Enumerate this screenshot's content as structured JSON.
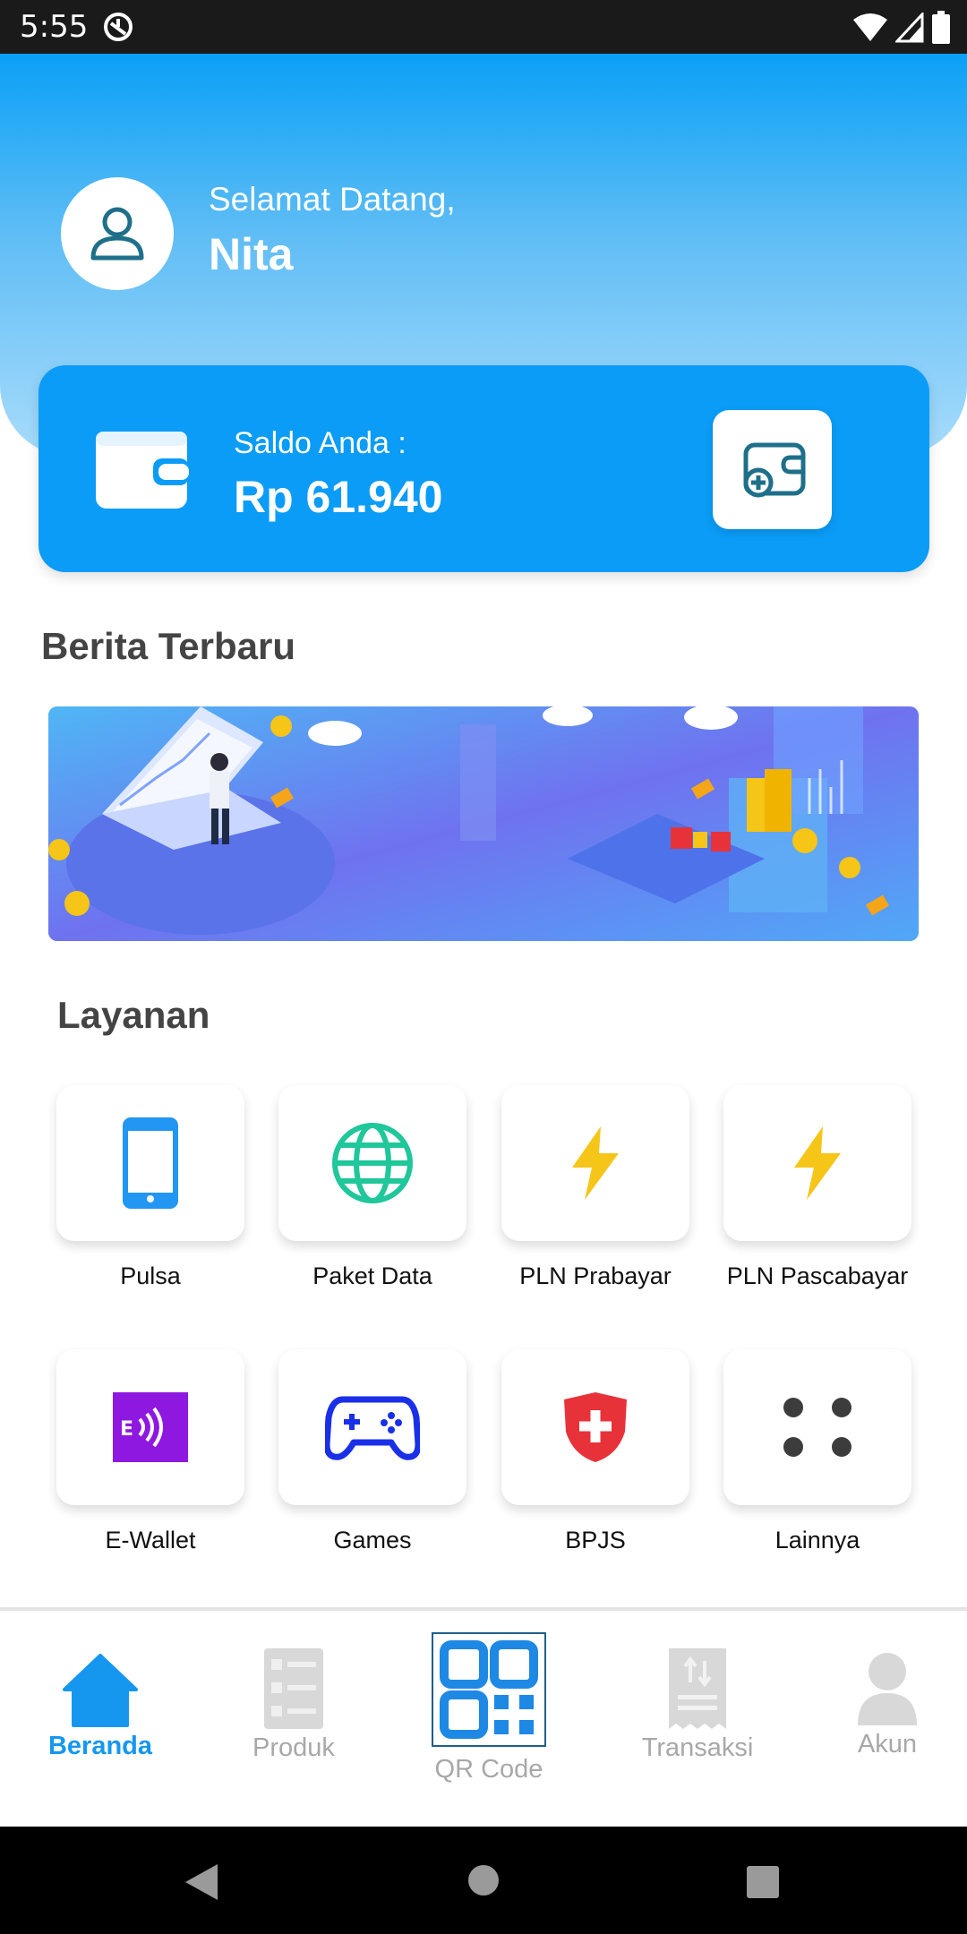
{
  "status_bar": {
    "time": "5:55"
  },
  "header": {
    "greeting": "Selamat Datang,",
    "username": "Nita"
  },
  "balance": {
    "label": "Saldo Anda :",
    "value": "Rp 61.940"
  },
  "news": {
    "title": "Berita Terbaru"
  },
  "services": {
    "title": "Layanan",
    "items": [
      {
        "label": "Pulsa",
        "icon": "phone-icon"
      },
      {
        "label": "Paket Data",
        "icon": "globe-icon"
      },
      {
        "label": "PLN Prabayar",
        "icon": "lightning-icon"
      },
      {
        "label": "PLN Pascabayar",
        "icon": "lightning-icon"
      },
      {
        "label": "E-Wallet",
        "icon": "ewallet-icon"
      },
      {
        "label": "Games",
        "icon": "gamepad-icon"
      },
      {
        "label": "BPJS",
        "icon": "shield-cross-icon"
      },
      {
        "label": "Lainnya",
        "icon": "more-dots-icon"
      }
    ]
  },
  "bottom_nav": {
    "items": [
      {
        "label": "Beranda",
        "icon": "home-icon",
        "active": true
      },
      {
        "label": "Produk",
        "icon": "product-list-icon"
      },
      {
        "label": "QR Code",
        "icon": "qr-code-icon"
      },
      {
        "label": "Transaksi",
        "icon": "receipt-icon"
      },
      {
        "label": "Akun",
        "icon": "account-icon"
      }
    ]
  },
  "colors": {
    "primary": "#0a9cf7",
    "active_nav": "#1597f0",
    "inactive_nav": "#a8a8a8",
    "lightning": "#f5c518",
    "globe": "#1fc79a",
    "ewallet": "#8f18e0",
    "gamepad": "#1a2fe8",
    "bpjs": "#e8323a"
  }
}
